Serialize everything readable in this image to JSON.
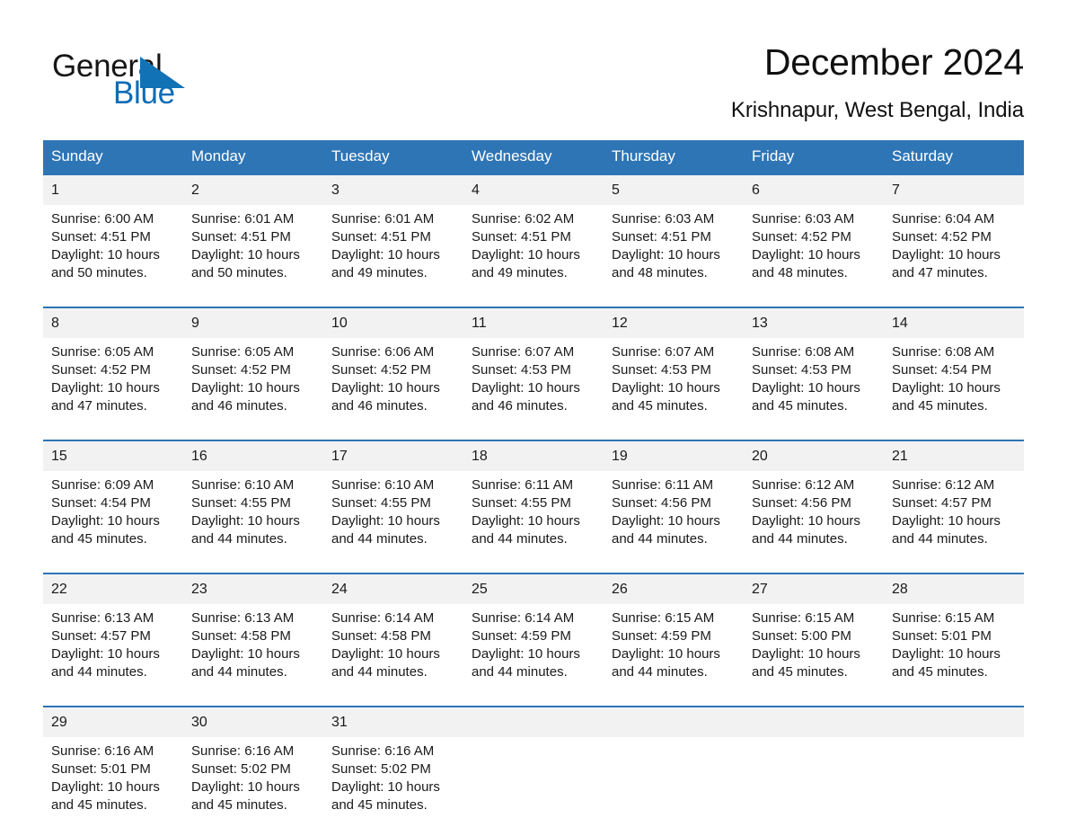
{
  "brand": {
    "word_general": "General",
    "word_blue": "Blue",
    "triangle_color": "#1272b6",
    "accent_color": "#2e75b6"
  },
  "header": {
    "title": "December 2024",
    "subtitle": "Krishnapur, West Bengal, India"
  },
  "weekdays": [
    "Sunday",
    "Monday",
    "Tuesday",
    "Wednesday",
    "Thursday",
    "Friday",
    "Saturday"
  ],
  "weeks": [
    [
      {
        "day": "1",
        "sunrise": "Sunrise: 6:00 AM",
        "sunset": "Sunset: 4:51 PM",
        "daylight": "Daylight: 10 hours and 50 minutes."
      },
      {
        "day": "2",
        "sunrise": "Sunrise: 6:01 AM",
        "sunset": "Sunset: 4:51 PM",
        "daylight": "Daylight: 10 hours and 50 minutes."
      },
      {
        "day": "3",
        "sunrise": "Sunrise: 6:01 AM",
        "sunset": "Sunset: 4:51 PM",
        "daylight": "Daylight: 10 hours and 49 minutes."
      },
      {
        "day": "4",
        "sunrise": "Sunrise: 6:02 AM",
        "sunset": "Sunset: 4:51 PM",
        "daylight": "Daylight: 10 hours and 49 minutes."
      },
      {
        "day": "5",
        "sunrise": "Sunrise: 6:03 AM",
        "sunset": "Sunset: 4:51 PM",
        "daylight": "Daylight: 10 hours and 48 minutes."
      },
      {
        "day": "6",
        "sunrise": "Sunrise: 6:03 AM",
        "sunset": "Sunset: 4:52 PM",
        "daylight": "Daylight: 10 hours and 48 minutes."
      },
      {
        "day": "7",
        "sunrise": "Sunrise: 6:04 AM",
        "sunset": "Sunset: 4:52 PM",
        "daylight": "Daylight: 10 hours and 47 minutes."
      }
    ],
    [
      {
        "day": "8",
        "sunrise": "Sunrise: 6:05 AM",
        "sunset": "Sunset: 4:52 PM",
        "daylight": "Daylight: 10 hours and 47 minutes."
      },
      {
        "day": "9",
        "sunrise": "Sunrise: 6:05 AM",
        "sunset": "Sunset: 4:52 PM",
        "daylight": "Daylight: 10 hours and 46 minutes."
      },
      {
        "day": "10",
        "sunrise": "Sunrise: 6:06 AM",
        "sunset": "Sunset: 4:52 PM",
        "daylight": "Daylight: 10 hours and 46 minutes."
      },
      {
        "day": "11",
        "sunrise": "Sunrise: 6:07 AM",
        "sunset": "Sunset: 4:53 PM",
        "daylight": "Daylight: 10 hours and 46 minutes."
      },
      {
        "day": "12",
        "sunrise": "Sunrise: 6:07 AM",
        "sunset": "Sunset: 4:53 PM",
        "daylight": "Daylight: 10 hours and 45 minutes."
      },
      {
        "day": "13",
        "sunrise": "Sunrise: 6:08 AM",
        "sunset": "Sunset: 4:53 PM",
        "daylight": "Daylight: 10 hours and 45 minutes."
      },
      {
        "day": "14",
        "sunrise": "Sunrise: 6:08 AM",
        "sunset": "Sunset: 4:54 PM",
        "daylight": "Daylight: 10 hours and 45 minutes."
      }
    ],
    [
      {
        "day": "15",
        "sunrise": "Sunrise: 6:09 AM",
        "sunset": "Sunset: 4:54 PM",
        "daylight": "Daylight: 10 hours and 45 minutes."
      },
      {
        "day": "16",
        "sunrise": "Sunrise: 6:10 AM",
        "sunset": "Sunset: 4:55 PM",
        "daylight": "Daylight: 10 hours and 44 minutes."
      },
      {
        "day": "17",
        "sunrise": "Sunrise: 6:10 AM",
        "sunset": "Sunset: 4:55 PM",
        "daylight": "Daylight: 10 hours and 44 minutes."
      },
      {
        "day": "18",
        "sunrise": "Sunrise: 6:11 AM",
        "sunset": "Sunset: 4:55 PM",
        "daylight": "Daylight: 10 hours and 44 minutes."
      },
      {
        "day": "19",
        "sunrise": "Sunrise: 6:11 AM",
        "sunset": "Sunset: 4:56 PM",
        "daylight": "Daylight: 10 hours and 44 minutes."
      },
      {
        "day": "20",
        "sunrise": "Sunrise: 6:12 AM",
        "sunset": "Sunset: 4:56 PM",
        "daylight": "Daylight: 10 hours and 44 minutes."
      },
      {
        "day": "21",
        "sunrise": "Sunrise: 6:12 AM",
        "sunset": "Sunset: 4:57 PM",
        "daylight": "Daylight: 10 hours and 44 minutes."
      }
    ],
    [
      {
        "day": "22",
        "sunrise": "Sunrise: 6:13 AM",
        "sunset": "Sunset: 4:57 PM",
        "daylight": "Daylight: 10 hours and 44 minutes."
      },
      {
        "day": "23",
        "sunrise": "Sunrise: 6:13 AM",
        "sunset": "Sunset: 4:58 PM",
        "daylight": "Daylight: 10 hours and 44 minutes."
      },
      {
        "day": "24",
        "sunrise": "Sunrise: 6:14 AM",
        "sunset": "Sunset: 4:58 PM",
        "daylight": "Daylight: 10 hours and 44 minutes."
      },
      {
        "day": "25",
        "sunrise": "Sunrise: 6:14 AM",
        "sunset": "Sunset: 4:59 PM",
        "daylight": "Daylight: 10 hours and 44 minutes."
      },
      {
        "day": "26",
        "sunrise": "Sunrise: 6:15 AM",
        "sunset": "Sunset: 4:59 PM",
        "daylight": "Daylight: 10 hours and 44 minutes."
      },
      {
        "day": "27",
        "sunrise": "Sunrise: 6:15 AM",
        "sunset": "Sunset: 5:00 PM",
        "daylight": "Daylight: 10 hours and 45 minutes."
      },
      {
        "day": "28",
        "sunrise": "Sunrise: 6:15 AM",
        "sunset": "Sunset: 5:01 PM",
        "daylight": "Daylight: 10 hours and 45 minutes."
      }
    ],
    [
      {
        "day": "29",
        "sunrise": "Sunrise: 6:16 AM",
        "sunset": "Sunset: 5:01 PM",
        "daylight": "Daylight: 10 hours and 45 minutes."
      },
      {
        "day": "30",
        "sunrise": "Sunrise: 6:16 AM",
        "sunset": "Sunset: 5:02 PM",
        "daylight": "Daylight: 10 hours and 45 minutes."
      },
      {
        "day": "31",
        "sunrise": "Sunrise: 6:16 AM",
        "sunset": "Sunset: 5:02 PM",
        "daylight": "Daylight: 10 hours and 45 minutes."
      },
      {
        "day": "",
        "sunrise": "",
        "sunset": "",
        "daylight": ""
      },
      {
        "day": "",
        "sunrise": "",
        "sunset": "",
        "daylight": ""
      },
      {
        "day": "",
        "sunrise": "",
        "sunset": "",
        "daylight": ""
      },
      {
        "day": "",
        "sunrise": "",
        "sunset": "",
        "daylight": ""
      }
    ]
  ]
}
